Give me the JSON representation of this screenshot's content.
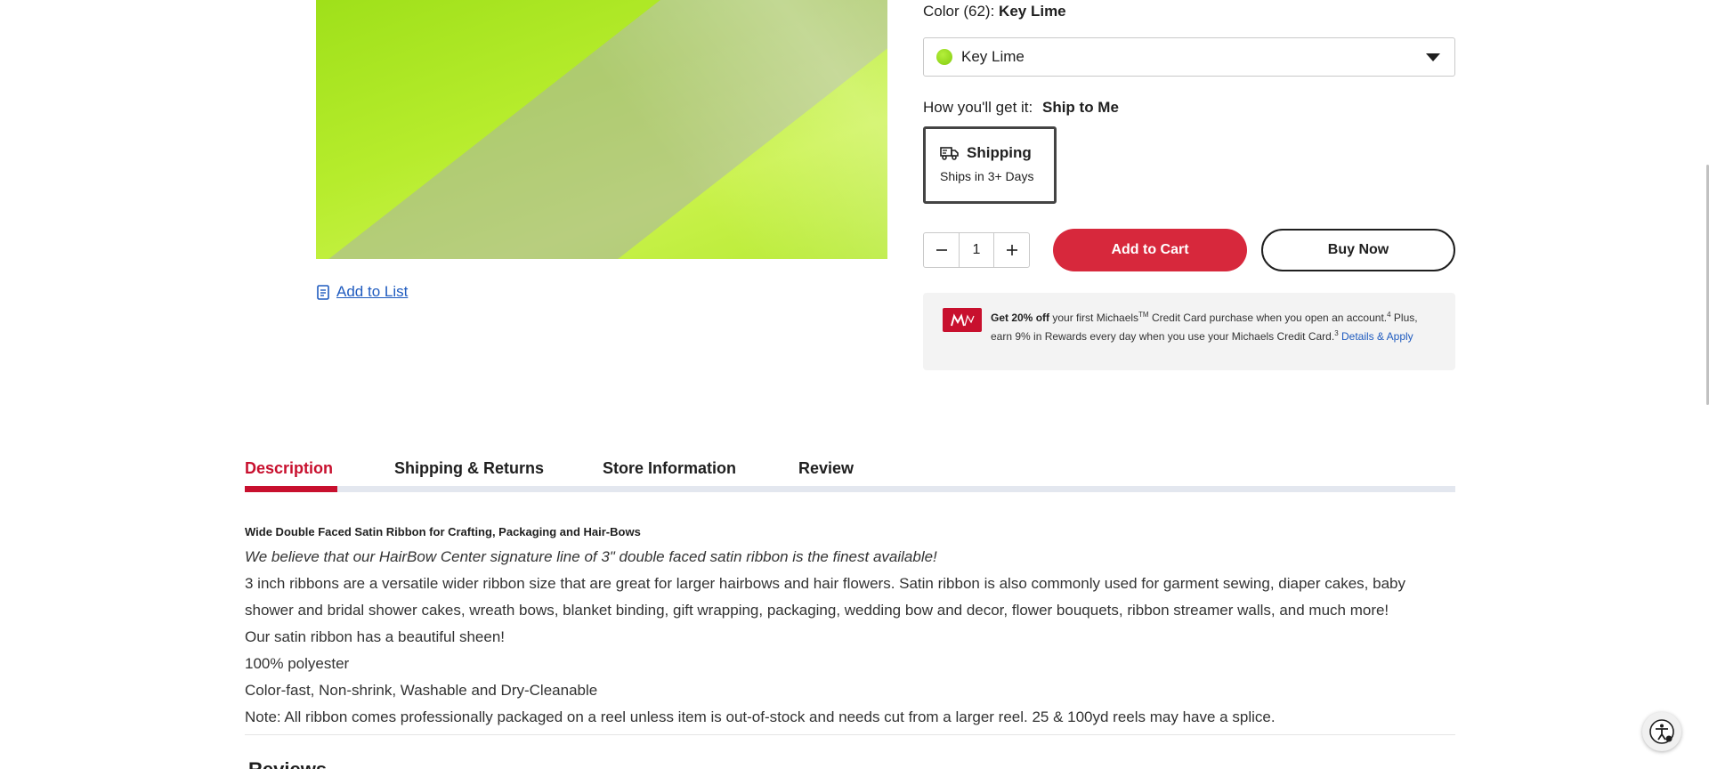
{
  "product": {
    "add_to_list": "Add to List"
  },
  "color": {
    "prefix": "Color (62):",
    "selected": "Key Lime",
    "dropdown_value": "Key Lime",
    "swatch_color": "#9ee01c"
  },
  "delivery": {
    "prefix": "How you'll get it:",
    "method": "Ship to Me",
    "option_title": "Shipping",
    "option_sub": "Ships in 3+ Days"
  },
  "quantity": {
    "value": "1"
  },
  "actions": {
    "add_to_cart": "Add to Cart",
    "buy_now": "Buy Now"
  },
  "promo": {
    "bold": "Get 20% off",
    "text1": " your first Michaels",
    "tm": "TM",
    "text2": " Credit Card purchase when you open an account.",
    "sup1": "4",
    "text3": " Plus, earn 9% in Rewards every day when you use your Michaels Credit Card.",
    "sup2": "3",
    "link": " Details & Apply"
  },
  "tabs": [
    {
      "label": "Description"
    },
    {
      "label": "Shipping & Returns"
    },
    {
      "label": "Store Information"
    },
    {
      "label": "Review"
    }
  ],
  "description": {
    "heading": "Wide Double Faced Satin Ribbon for Crafting, Packaging and Hair-Bows",
    "tagline": "We believe that our HairBow Center signature line of 3\" double faced satin ribbon is the finest available!",
    "para1": "3 inch ribbons are a versatile wider ribbon size that are great for larger hairbows and hair flowers. Satin ribbon is also commonly used for garment sewing, diaper cakes, baby shower and bridal shower cakes, wreath bows, blanket binding, gift wrapping, packaging, wedding bow and decor, flower bouquets, ribbon streamer walls, and much more!",
    "para2": "Our satin ribbon has a beautiful sheen!",
    "para3": "100% polyester",
    "para4": "Color-fast, Non-shrink, Washable and Dry-Cleanable",
    "para5": "Note: All ribbon comes professionally packaged on a reel unless item is out-of-stock and needs cut from a larger reel. 25 & 100yd reels may have a splice.",
    "next_section": "Reviews"
  },
  "colors": {
    "brand_red": "#d7283c",
    "link_blue": "#1f5bbf"
  }
}
